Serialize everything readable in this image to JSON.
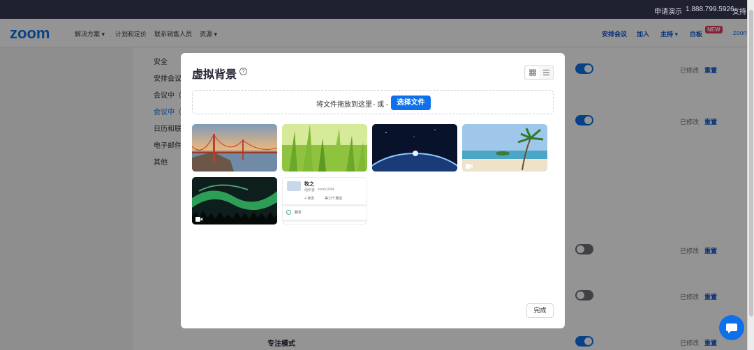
{
  "topbar": {
    "request_demo": "申请演示",
    "phone": "1.888.799.5926",
    "support": "支持"
  },
  "nav": {
    "logo": "zoom",
    "solutions": "解决方案 ▾",
    "pricing": "计划和定价",
    "contact_sales": "联系销售人员",
    "resources": "资源 ▾",
    "schedule": "安排会议",
    "join": "加入",
    "host": "主持 ▾",
    "whiteboard": "白板",
    "new_badge": "NEW",
    "zoom_small": "zoom"
  },
  "sidebar": {
    "items": [
      {
        "label": "安全"
      },
      {
        "label": "安排会议"
      },
      {
        "label": "会议中（基"
      },
      {
        "label": "会议中（高"
      },
      {
        "label": "日历和联系"
      },
      {
        "label": "电子邮件通"
      },
      {
        "label": "其他"
      }
    ]
  },
  "settings_rows": [
    {
      "toggle": "on",
      "modified": "已修改",
      "reset": "重置"
    },
    {
      "toggle": "on",
      "modified": "已修改",
      "reset": "重置"
    },
    {
      "toggle": "off",
      "modified": "已修改",
      "reset": "重置"
    },
    {
      "toggle": "off",
      "modified": "已修改",
      "reset": "重置"
    },
    {
      "toggle": "on",
      "modified": "已修改",
      "reset": "重置"
    }
  ],
  "focus_mode_label": "专注模式",
  "modal": {
    "title": "虚拟背景",
    "help_glyph": "?",
    "dropzone": {
      "text": "将文件拖放到这里",
      "or": "- 或 -",
      "choose_button": "选择文件"
    },
    "backgrounds": [
      {
        "name": "golden-gate-bridge",
        "has_video": false
      },
      {
        "name": "grass",
        "has_video": false
      },
      {
        "name": "earth-from-space",
        "has_video": false
      },
      {
        "name": "beach-palm",
        "has_video": true
      },
      {
        "name": "aurora",
        "has_video": true
      }
    ],
    "mock_card": {
      "name": "牧之",
      "subtitle_1": "组织者",
      "subtitle_2": "zoom1044",
      "status_1": "+ 状态",
      "status_2": "等17个朋友",
      "service": "服务"
    },
    "done_button": "完成"
  },
  "colors": {
    "accent": "#0e71eb",
    "topbar": "#1f2130"
  }
}
